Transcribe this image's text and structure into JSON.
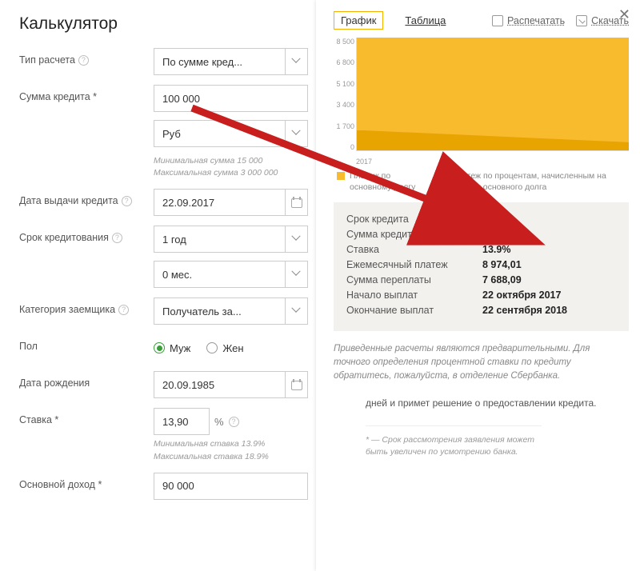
{
  "title": "Калькулятор",
  "form": {
    "calc_type": {
      "label": "Тип расчета",
      "value": "По сумме кред..."
    },
    "amount": {
      "label": "Сумма кредита *",
      "value": "100 000",
      "currency": "Руб",
      "hint_min": "Минимальная сумма 15 000",
      "hint_max": "Максимальная сумма 3 000 000"
    },
    "issue_date": {
      "label": "Дата выдачи кредита",
      "value": "22.09.2017"
    },
    "term": {
      "label": "Срок кредитования",
      "years": "1 год",
      "months": "0 мес."
    },
    "category": {
      "label": "Категория заемщика",
      "value": "Получатель за..."
    },
    "gender": {
      "label": "Пол",
      "male": "Муж",
      "female": "Жен",
      "selected": "male"
    },
    "birth": {
      "label": "Дата рождения",
      "value": "20.09.1985"
    },
    "rate": {
      "label": "Ставка *",
      "value": "13,90",
      "pct": "%",
      "hint_min": "Минимальная ставка 13.9%",
      "hint_max": "Максимальная ставка 18.9%"
    },
    "income": {
      "label": "Основной доход *",
      "value": "90 000"
    }
  },
  "panel": {
    "tab_chart": "График",
    "tab_table": "Таблица",
    "print": "Распечатать",
    "download": "Скачать",
    "legend1": "Платеж по основному долгу",
    "legend2": "Платеж по процентам, начисленным на остаток основного долга",
    "xlabel": "2017"
  },
  "summary": {
    "term_k": "Срок кредита",
    "term_v": "12 мес.",
    "amount_k": "Сумма кредита",
    "amount_v": "100 000",
    "rate_k": "Ставка",
    "rate_v": "13.9%",
    "pay_k": "Ежемесячный платеж",
    "pay_v": "8 974,01",
    "over_k": "Сумма переплаты",
    "over_v": "7 688,09",
    "start_k": "Начало выплат",
    "start_v": "22 октября 2017",
    "end_k": "Окончание выплат",
    "end_v": "22 сентября 2018"
  },
  "disclaimer": "Приведенные расчеты являются предварительными. Для точного определения процентной ставки по кредиту обратитесь, пожалуйста, в отделение Сбербанка.",
  "behind": {
    "text": "дней и примет решение о предоставлении кредита.",
    "note": "* — Срок рассмотрения заявления может быть увеличен по усмотрению банка."
  },
  "chart_data": {
    "type": "area",
    "yticks": [
      "8 500",
      "6 800",
      "5 100",
      "3 400",
      "1 700",
      "0"
    ],
    "xlabel": "2017",
    "series": [
      {
        "name": "Платеж по основному долгу",
        "color": "#f9bb2e"
      },
      {
        "name": "Платеж по процентам",
        "color": "#e8a400"
      }
    ],
    "ylim": [
      0,
      8500
    ]
  }
}
